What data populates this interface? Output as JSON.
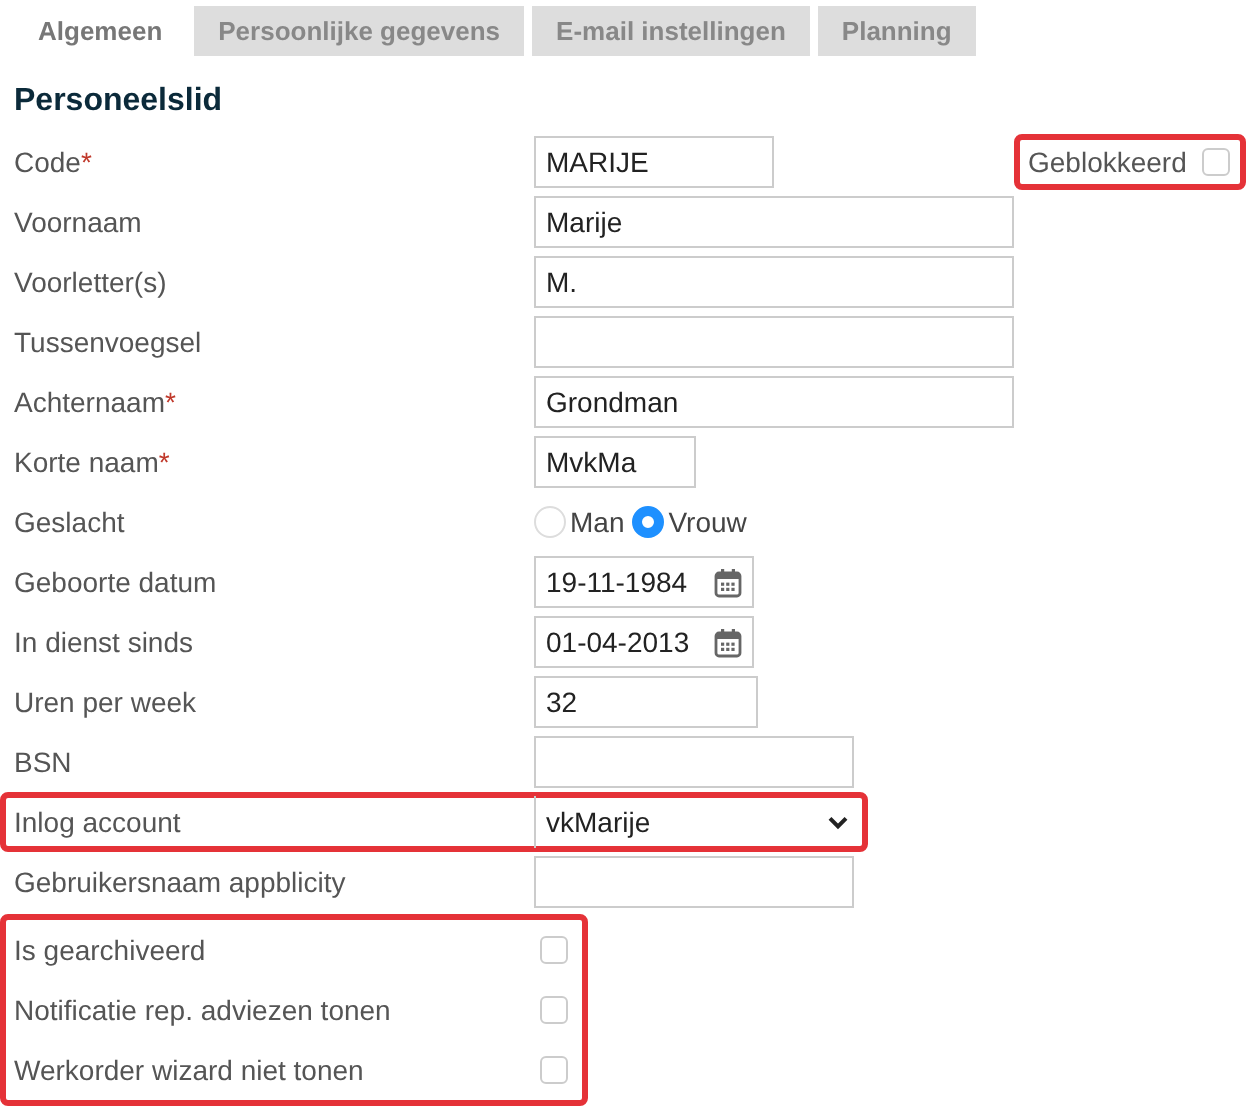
{
  "tabs": [
    {
      "label": "Algemeen",
      "selected": true
    },
    {
      "label": "Persoonlijke gegevens",
      "selected": false
    },
    {
      "label": "E-mail instellingen",
      "selected": false
    },
    {
      "label": "Planning",
      "selected": false
    }
  ],
  "section_title": "Personeelslid",
  "rows": [
    {
      "label": "Code",
      "required_mark": "*",
      "kind": "text",
      "value": "MARIJE",
      "highlighted": false,
      "extra": {
        "label": "Geblokkeerd",
        "checked": false,
        "highlighted": true
      }
    },
    {
      "label": "Voornaam",
      "kind": "text",
      "value": "Marije",
      "highlighted": false
    },
    {
      "label": "Voorletter(s)",
      "kind": "text",
      "value": "M.",
      "highlighted": false
    },
    {
      "label": "Tussenvoegsel",
      "kind": "text",
      "highlighted": false
    },
    {
      "label": "Achternaam",
      "required_mark": "*",
      "kind": "text",
      "value": "Grondman",
      "highlighted": false
    },
    {
      "label": "Korte naam",
      "required_mark": "*",
      "kind": "text",
      "value": "MvkMa",
      "highlighted": false
    },
    {
      "label": "Geslacht",
      "kind": "radio",
      "options": [
        {
          "label": "Man",
          "selected": false
        },
        {
          "label": "Vrouw",
          "selected": true
        }
      ],
      "highlighted": false
    },
    {
      "label": "Geboorte datum",
      "kind": "date",
      "value": "19-11-1984",
      "highlighted": false
    },
    {
      "label": "In dienst sinds",
      "kind": "date",
      "value": "01-04-2013",
      "highlighted": false
    },
    {
      "label": "Uren per week",
      "kind": "text",
      "value": "32",
      "highlighted": false
    },
    {
      "label": "BSN",
      "kind": "text",
      "highlighted": false
    },
    {
      "label": "Inlog account",
      "kind": "select",
      "value": "vkMarije",
      "highlighted": true
    },
    {
      "label": "Gebruikersnaam appblicity",
      "kind": "text",
      "highlighted": false
    }
  ],
  "options_highlighted": true,
  "options": [
    {
      "label": "Is gearchiveerd",
      "checked": false
    },
    {
      "label": "Notificatie rep. adviezen tonen",
      "checked": false
    },
    {
      "label": "Werkorder wizard niet tonen",
      "checked": false
    }
  ]
}
